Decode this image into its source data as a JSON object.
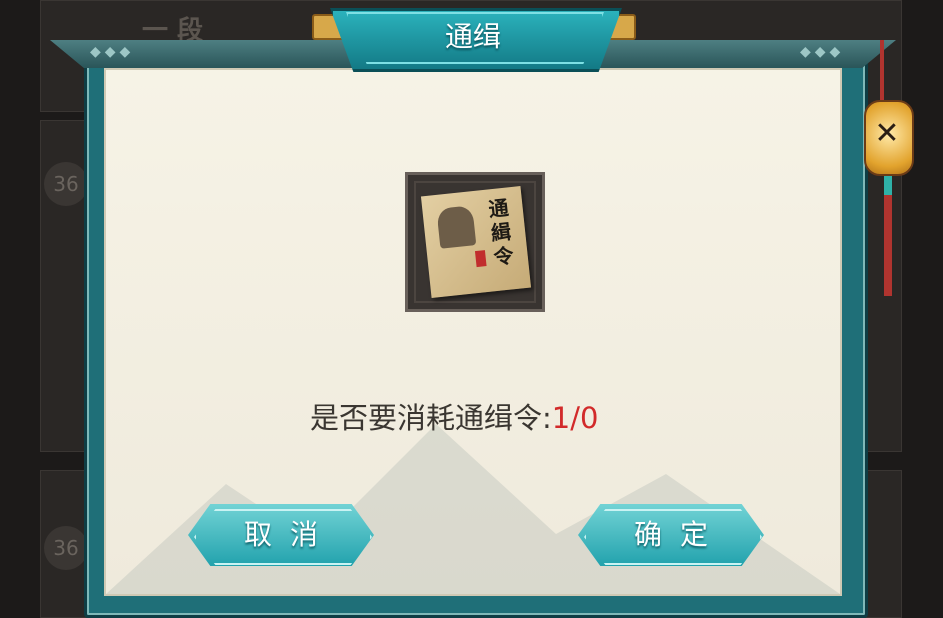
{
  "background": {
    "rank_text": "一 段",
    "circle_1": "36",
    "circle_2": "36"
  },
  "dialog": {
    "title": "通缉",
    "item": {
      "poster_text": "通緝令"
    },
    "question_prefix": "是否要消耗通缉令:",
    "question_count": "1/0",
    "cancel_label": "取消",
    "confirm_label": "确定"
  },
  "colors": {
    "accent": "#1f9aa6",
    "count_red": "#d22a2a"
  }
}
